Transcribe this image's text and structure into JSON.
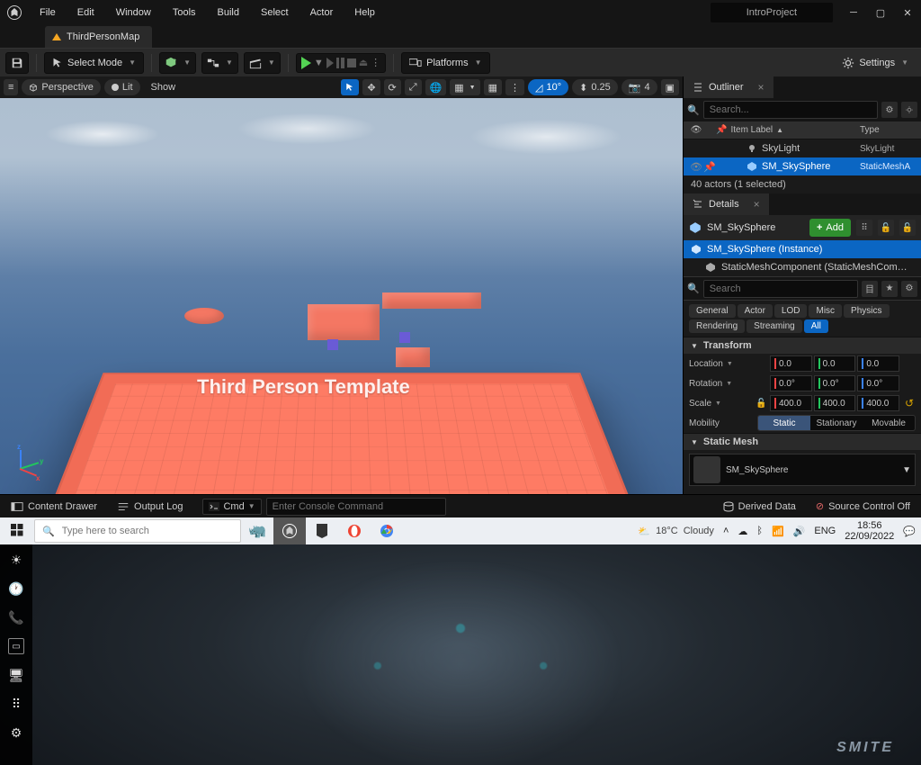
{
  "menus": [
    "File",
    "Edit",
    "Window",
    "Tools",
    "Build",
    "Select",
    "Actor",
    "Help"
  ],
  "project_name": "IntroProject",
  "doc_tab": "ThirdPersonMap",
  "select_mode_label": "Select Mode",
  "platforms_label": "Platforms",
  "settings_label": "Settings",
  "viewport": {
    "perspective": "Perspective",
    "lit": "Lit",
    "show": "Show",
    "snap_angle": "10°",
    "snap_scale": "0.25",
    "cam_speed": "4",
    "overlay_text": "Third Person Template"
  },
  "outliner": {
    "title": "Outliner",
    "search_placeholder": "Search...",
    "header_label": "Item Label",
    "header_type": "Type",
    "rows": [
      {
        "name": "SkyLight",
        "type": "SkyLight",
        "selected": false
      },
      {
        "name": "SM_SkySphere",
        "type": "StaticMeshA",
        "selected": true
      }
    ],
    "footer": "40 actors (1 selected)"
  },
  "details": {
    "title": "Details",
    "actor": "SM_SkySphere",
    "add_label": "Add",
    "components": [
      "SM_SkySphere (Instance)",
      "StaticMeshComponent (StaticMeshComponent)"
    ],
    "search_placeholder": "Search",
    "categories": [
      "General",
      "Actor",
      "LOD",
      "Misc",
      "Physics",
      "Rendering",
      "Streaming",
      "All"
    ],
    "active_category": "All",
    "transform": {
      "header": "Transform",
      "location_label": "Location",
      "rotation_label": "Rotation",
      "scale_label": "Scale",
      "mobility_label": "Mobility",
      "location": [
        "0.0",
        "0.0",
        "0.0"
      ],
      "rotation": [
        "0.0°",
        "0.0°",
        "0.0°"
      ],
      "scale": [
        "400.0",
        "400.0",
        "400.0"
      ],
      "mobility_options": [
        "Static",
        "Stationary",
        "Movable"
      ],
      "mobility_selected": "Static"
    },
    "static_mesh_header": "Static Mesh",
    "static_mesh_value": "SM_SkySphere"
  },
  "status": {
    "content_drawer": "Content Drawer",
    "output_log": "Output Log",
    "cmd_label": "Cmd",
    "cmd_placeholder": "Enter Console Command",
    "derived_data": "Derived Data",
    "source_control": "Source Control Off"
  },
  "taskbar": {
    "search_placeholder": "Type here to search",
    "weather_temp": "18°C",
    "weather_cond": "Cloudy",
    "lang": "ENG",
    "time": "18:56",
    "date": "22/09/2022",
    "smite": "SMITE"
  }
}
